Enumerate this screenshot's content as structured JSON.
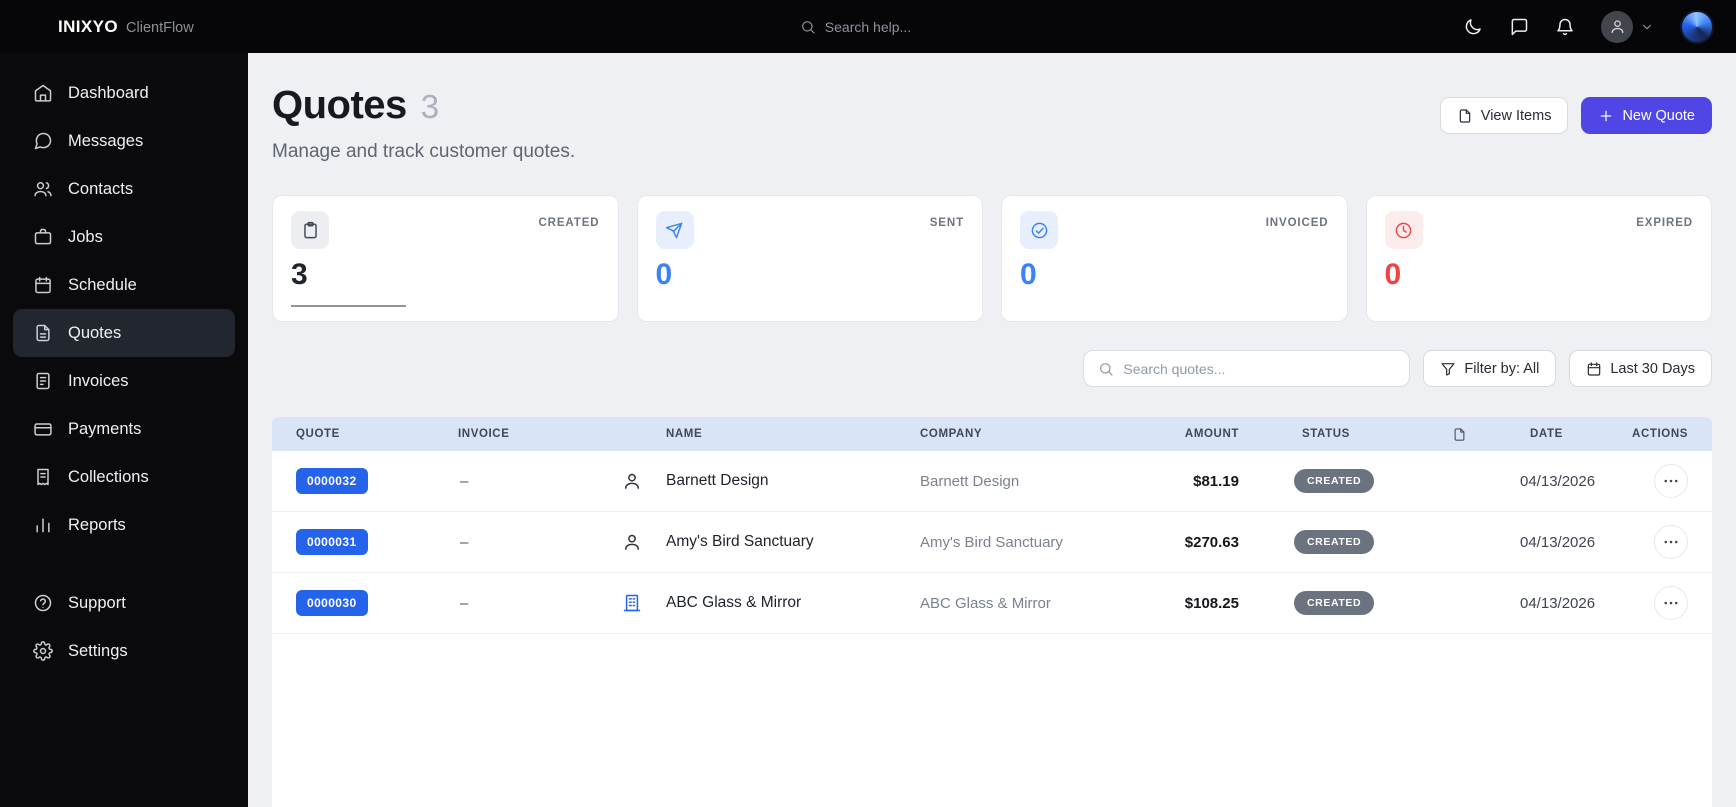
{
  "topbar": {
    "brand": "INIXYO",
    "product": "ClientFlow",
    "search_placeholder": "Search help..."
  },
  "sidebar": {
    "items": [
      {
        "label": "Dashboard",
        "icon": "home"
      },
      {
        "label": "Messages",
        "icon": "chat-bubble"
      },
      {
        "label": "Contacts",
        "icon": "users"
      },
      {
        "label": "Jobs",
        "icon": "briefcase"
      },
      {
        "label": "Schedule",
        "icon": "calendar"
      },
      {
        "label": "Quotes",
        "icon": "document"
      },
      {
        "label": "Invoices",
        "icon": "invoice"
      },
      {
        "label": "Payments",
        "icon": "card"
      },
      {
        "label": "Collections",
        "icon": "receipt"
      },
      {
        "label": "Reports",
        "icon": "chart"
      }
    ],
    "footer_items": [
      {
        "label": "Support",
        "icon": "help-circle"
      },
      {
        "label": "Settings",
        "icon": "gear"
      }
    ],
    "active_item": "Quotes"
  },
  "page": {
    "title": "Quotes",
    "count": "3",
    "subtitle": "Manage and track customer quotes.",
    "actions": {
      "view_items": "View Items",
      "new_quote": "New Quote"
    }
  },
  "stats": [
    {
      "label": "CREATED",
      "value": "3",
      "icon": "clipboard"
    },
    {
      "label": "SENT",
      "value": "0",
      "icon": "send"
    },
    {
      "label": "INVOICED",
      "value": "0",
      "icon": "check-circle"
    },
    {
      "label": "EXPIRED",
      "value": "0",
      "icon": "clock"
    }
  ],
  "filters": {
    "search_placeholder": "Search quotes...",
    "filter_by": "Filter by: All",
    "date_range": "Last 30 Days"
  },
  "table": {
    "headers": {
      "quote": "QUOTE",
      "invoice": "INVOICE",
      "name": "NAME",
      "company": "COMPANY",
      "amount": "AMOUNT",
      "status": "STATUS",
      "date": "DATE",
      "actions": "ACTIONS"
    },
    "rows": [
      {
        "quote": "0000032",
        "invoice": "–",
        "customer_type": "person",
        "name": "Barnett Design",
        "company": "Barnett Design",
        "amount": "$81.19",
        "status": "CREATED",
        "date": "04/13/2026"
      },
      {
        "quote": "0000031",
        "invoice": "–",
        "customer_type": "person",
        "name": "Amy's Bird Sanctuary",
        "company": "Amy's Bird Sanctuary",
        "amount": "$270.63",
        "status": "CREATED",
        "date": "04/13/2026"
      },
      {
        "quote": "0000030",
        "invoice": "–",
        "customer_type": "business",
        "name": "ABC Glass & Mirror",
        "company": "ABC Glass & Mirror",
        "amount": "$108.25",
        "status": "CREATED",
        "date": "04/13/2026"
      }
    ]
  },
  "colors": {
    "accent": "#4f46e5",
    "badge_blue": "#2563eb",
    "stat_blue": "#3b82f6",
    "stat_red": "#ef4444",
    "status_gray": "#6b7280",
    "table_header_bg": "#d9e4f7"
  }
}
